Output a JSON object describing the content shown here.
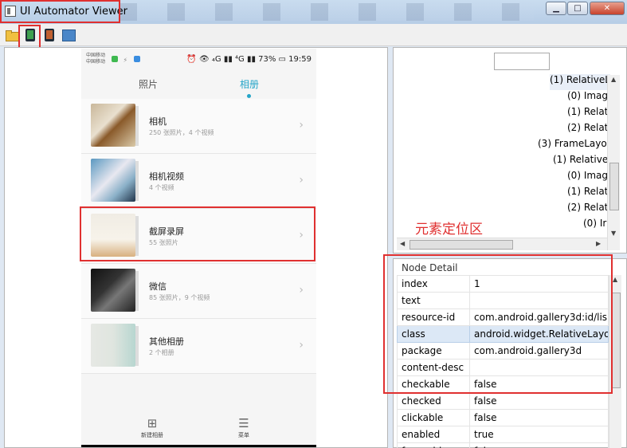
{
  "window": {
    "title": "UI Automator Viewer",
    "buttons": {
      "minimize": "▁",
      "maximize": "□",
      "close": "✕"
    }
  },
  "toolbar": {
    "icons": [
      "folder-open-icon",
      "device-screenshot-icon",
      "device-screenshot-compressed-icon",
      "save-icon"
    ]
  },
  "device": {
    "status": {
      "carrier1": "中国移动",
      "carrier2": "中国移动",
      "right": "⏰ 👁 ₄G ▮▮ ⁴G ▮▮ 73% ▭ 19:59"
    },
    "tabs": [
      {
        "label": "照片",
        "active": false
      },
      {
        "label": "相册",
        "active": true
      }
    ],
    "albums": [
      {
        "name": "相机",
        "count": "250 张照片，4 个视频"
      },
      {
        "name": "相机视频",
        "count": "4 个视频"
      },
      {
        "name": "截屏录屏",
        "count": "55 张照片"
      },
      {
        "name": "微信",
        "count": "85 张照片，9 个视频"
      },
      {
        "name": "其他相册",
        "count": "2 个相册"
      }
    ],
    "bottom": {
      "new_album": "新建相册",
      "menu": "菜单"
    }
  },
  "tree": {
    "rows": [
      "(1) RelativeL",
      "(0) Imag",
      "(1) Relat",
      "(2) Relat",
      "(3) FrameLayou",
      "(1) RelativeL",
      "(0) Imag",
      "(1) Relat",
      "(2) Relat",
      "(0) Ir"
    ],
    "annotation": "元素定位区"
  },
  "detail": {
    "title": "Node Detail",
    "rows": [
      {
        "key": "index",
        "value": "1"
      },
      {
        "key": "text",
        "value": ""
      },
      {
        "key": "resource-id",
        "value": "com.android.gallery3d:id/lis."
      },
      {
        "key": "class",
        "value": "android.widget.RelativeLayou"
      },
      {
        "key": "package",
        "value": "com.android.gallery3d"
      },
      {
        "key": "content-desc",
        "value": ""
      },
      {
        "key": "checkable",
        "value": "false"
      },
      {
        "key": "checked",
        "value": "false"
      },
      {
        "key": "clickable",
        "value": "false"
      },
      {
        "key": "enabled",
        "value": "true"
      },
      {
        "key": "focusable",
        "value": "false"
      }
    ]
  },
  "colors": {
    "highlight": "#e03030",
    "accent": "#25a5c8"
  }
}
